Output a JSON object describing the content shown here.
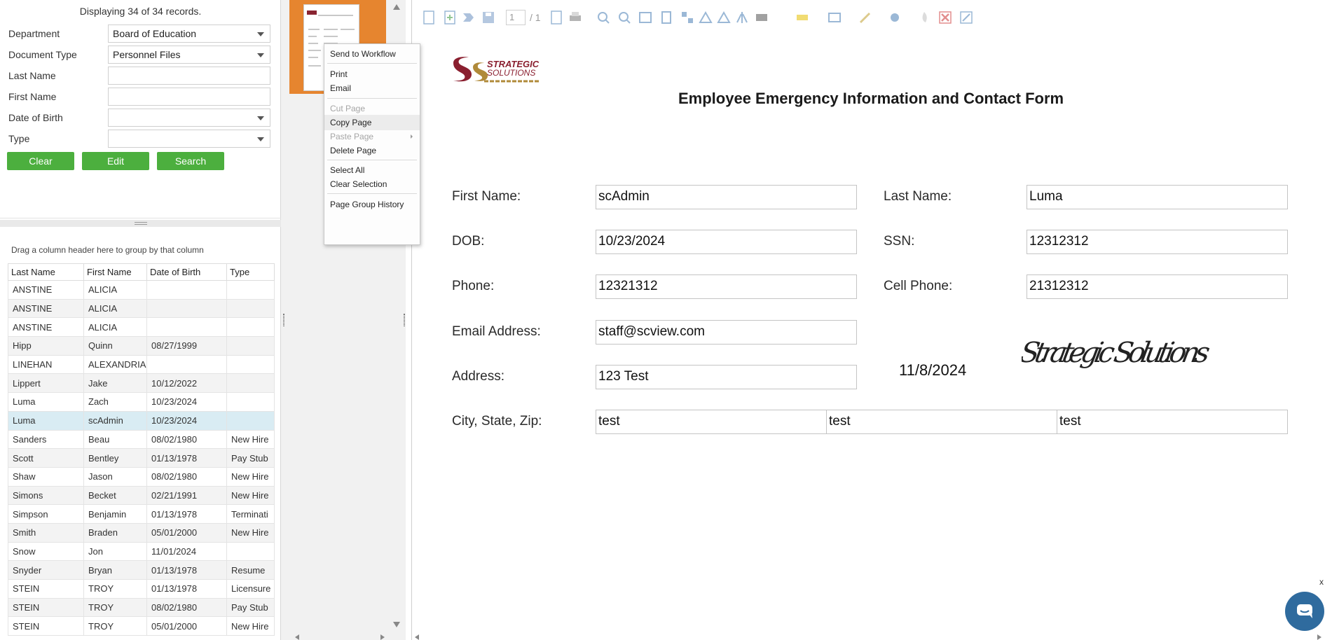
{
  "search_panel": {
    "record_count": "Displaying 34 of 34 records.",
    "fields": [
      {
        "label": "Department",
        "value": "Board of Education"
      },
      {
        "label": "Document Type",
        "value": "Personnel Files"
      },
      {
        "label": "Last Name",
        "value": ""
      },
      {
        "label": "First Name",
        "value": ""
      },
      {
        "label": "Date of Birth",
        "value": ""
      },
      {
        "label": "Type",
        "value": ""
      }
    ],
    "buttons": {
      "clear": "Clear",
      "edit": "Edit",
      "search": "Search"
    },
    "accent_color": "#4caf3e"
  },
  "grid": {
    "group_hint": "Drag a column header here to group by that column",
    "columns": [
      "Last Name",
      "First Name",
      "Date of Birth",
      "Type"
    ],
    "rows": [
      [
        "ANSTINE",
        "ALICIA",
        "",
        ""
      ],
      [
        "ANSTINE",
        "ALICIA",
        "",
        ""
      ],
      [
        "ANSTINE",
        "ALICIA",
        "",
        ""
      ],
      [
        "Hipp",
        "Quinn",
        "08/27/1999",
        ""
      ],
      [
        "LINEHAN",
        "ALEXANDRIA",
        "",
        ""
      ],
      [
        "Lippert",
        "Jake",
        "10/12/2022",
        ""
      ],
      [
        "Luma",
        "Zach",
        "10/23/2024",
        ""
      ],
      [
        "Luma",
        "scAdmin",
        "10/23/2024",
        ""
      ],
      [
        "Sanders",
        "Beau",
        "08/02/1980",
        "New Hire"
      ],
      [
        "Scott",
        "Bentley",
        "01/13/1978",
        "Pay Stub"
      ],
      [
        "Shaw",
        "Jason",
        "08/02/1980",
        "New Hire"
      ],
      [
        "Simons",
        "Becket",
        "02/21/1991",
        "New Hire"
      ],
      [
        "Simpson",
        "Benjamin",
        "01/13/1978",
        "Terminati"
      ],
      [
        "Smith",
        "Braden",
        "05/01/2000",
        "New Hire"
      ],
      [
        "Snow",
        "Jon",
        "11/01/2024",
        ""
      ],
      [
        "Snyder",
        "Bryan",
        "01/13/1978",
        "Resume"
      ],
      [
        "STEIN",
        "TROY",
        "01/13/1978",
        "Licensure"
      ],
      [
        "STEIN",
        "TROY",
        "08/02/1980",
        "Pay Stub"
      ],
      [
        "STEIN",
        "TROY",
        "05/01/2000",
        "New Hire"
      ]
    ],
    "selected_row_index": 7
  },
  "context_menu": {
    "items": [
      {
        "label": "Send to Workflow",
        "disabled": false
      },
      {
        "label": "Print",
        "disabled": false
      },
      {
        "label": "Email",
        "disabled": false
      },
      {
        "label": "Cut Page",
        "disabled": true
      },
      {
        "label": "Copy Page",
        "disabled": false
      },
      {
        "label": "Paste Page",
        "disabled": true
      },
      {
        "label": "Delete Page",
        "disabled": false
      },
      {
        "label": "Select All",
        "disabled": false
      },
      {
        "label": "Clear Selection",
        "disabled": false
      },
      {
        "label": "Page Group History",
        "disabled": false
      }
    ]
  },
  "toolbar": {
    "page_input": "1",
    "page_total": "/ 1",
    "icons": [
      "new-page-icon",
      "add-page-icon",
      "send-icon",
      "save-icon",
      "page-nav-icon",
      "print-icon",
      "zoom-in-icon",
      "zoom-out-icon",
      "fit-icon",
      "page-icon",
      "thumbnails-icon",
      "rotate-left-icon",
      "rotate-right-icon",
      "flip-icon",
      "redact-icon",
      "highlight-icon",
      "text-icon",
      "pen-icon",
      "stamp-icon",
      "fire-icon",
      "delete-icon",
      "edit-icon"
    ]
  },
  "document": {
    "company_line1": "STRATEGIC",
    "company_line2": "SOLUTIONS",
    "title": "Employee Emergency Information and Contact Form",
    "labels": {
      "first_name": "First Name:",
      "last_name": "Last Name:",
      "dob": "DOB:",
      "ssn": "SSN:",
      "phone": "Phone:",
      "cell_phone": "Cell Phone:",
      "email": "Email Address:",
      "address": "Address:",
      "city_state_zip": "City, State, Zip:"
    },
    "values": {
      "first_name": "scAdmin",
      "last_name": "Luma",
      "dob": "10/23/2024",
      "ssn": "12312312",
      "phone": "12321312",
      "cell_phone": "21312312",
      "email": "staff@scview.com",
      "address": "123 Test",
      "city": "test",
      "state": "test",
      "zip": "test"
    },
    "signature_date": "11/8/2024",
    "signature_text": "Strategic Solutions"
  },
  "chat": {
    "close_label": "x",
    "color": "#2f6b9e"
  }
}
